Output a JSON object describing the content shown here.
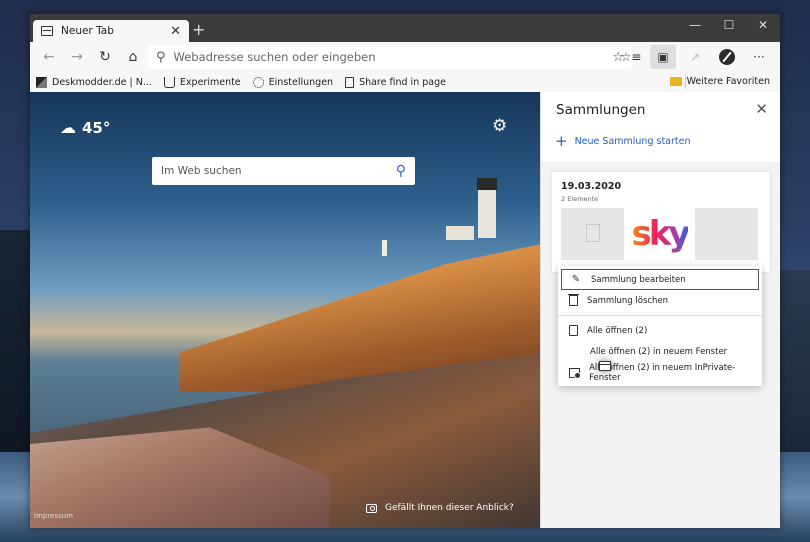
{
  "browser": {
    "tab": {
      "title": "Neuer Tab",
      "close": "✕",
      "favicon": "tab-page-icon"
    },
    "new_tab": "+",
    "window_controls": {
      "minimize": "—",
      "maximize": "☐",
      "close": "✕"
    },
    "address": {
      "placeholder": "Webadresse suchen oder eingeben"
    },
    "nav": {
      "back": "←",
      "forward": "→",
      "refresh": "↻",
      "home": "⌂"
    },
    "toolbar": {
      "star": "☆",
      "favorites": "☆≡",
      "collections": "▣",
      "share": "↗",
      "more": "···"
    }
  },
  "favorites_bar": {
    "items": [
      {
        "label": "Deskmodder.de | N...",
        "icon": "deskmodder-icon"
      },
      {
        "label": "Experimente",
        "icon": "beaker-icon"
      },
      {
        "label": "Einstellungen",
        "icon": "gear-icon"
      },
      {
        "label": "Share find in page",
        "icon": "page-icon"
      }
    ],
    "other": "Weitere Favoriten"
  },
  "new_tab_page": {
    "weather": {
      "temp": "45°",
      "icon": "partly-cloudy-icon"
    },
    "search": {
      "placeholder": "Im Web suchen"
    },
    "impressum": "Impressum",
    "like_view": "Gefällt Ihnen dieser Anblick?"
  },
  "collections": {
    "title": "Sammlungen",
    "new_collection": "Neue Sammlung starten",
    "card": {
      "date": "19.03.2020",
      "count": "2 Elemente"
    },
    "menu": {
      "edit": "Sammlung bearbeiten",
      "delete": "Sammlung löschen",
      "open_all": "Alle öffnen (2)",
      "open_new_window": "Alle öffnen (2) in neuem Fenster",
      "open_inprivate": "Alle öffnen (2) in neuem InPrivate-Fenster"
    }
  },
  "colors": {
    "accent": "#2462b9",
    "titlebar": "#3b3b3b"
  }
}
